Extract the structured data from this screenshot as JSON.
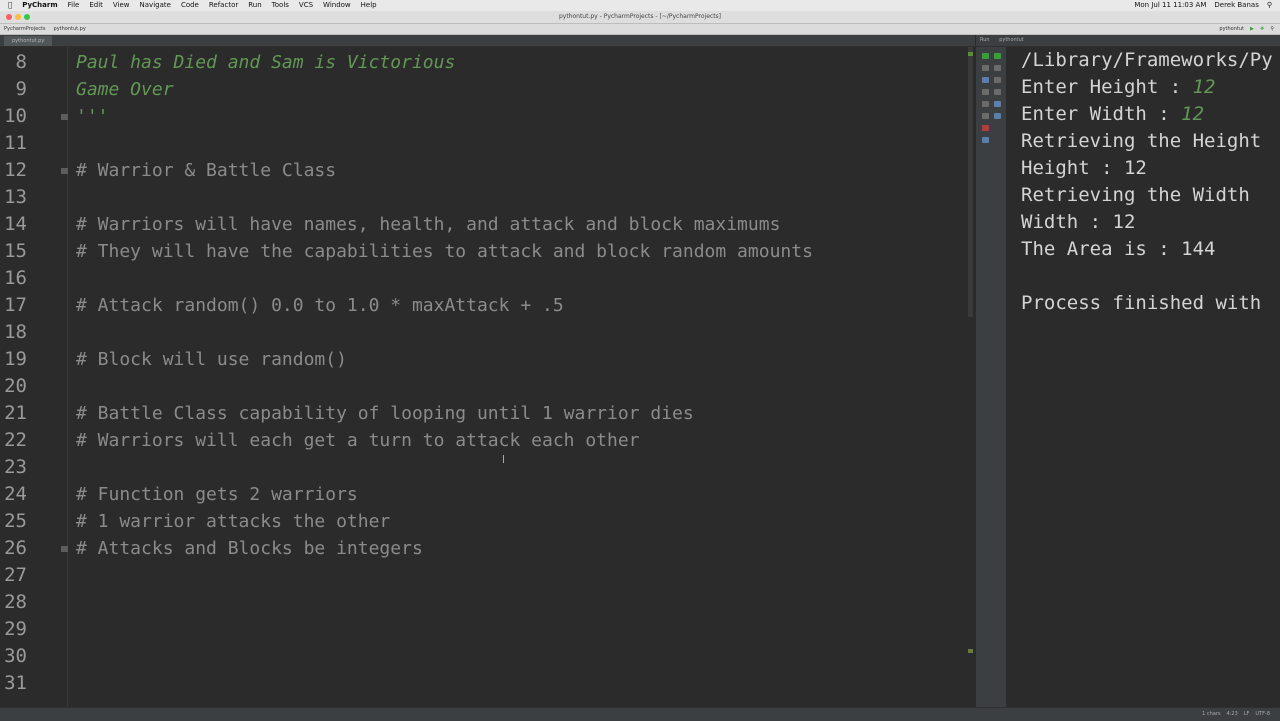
{
  "menubar": {
    "app": "PyCharm",
    "items": [
      "File",
      "Edit",
      "View",
      "Navigate",
      "Code",
      "Refactor",
      "Run",
      "Tools",
      "VCS",
      "Window",
      "Help"
    ],
    "clock": "Mon Jul 11  11:03 AM",
    "user": "Derek Banas"
  },
  "window": {
    "title": "pythontut.py - PycharmProjects - [~/PycharmProjects]"
  },
  "navbar": {
    "breadcrumbs": [
      "PycharmProjects",
      "pythontut.py"
    ],
    "run_config": "pythontut"
  },
  "editor": {
    "tab": "pythontut.py",
    "lines": [
      {
        "num": "8",
        "text": "Paul has Died and Sam is Victorious",
        "kind": "doc"
      },
      {
        "num": "9",
        "text": "Game Over",
        "kind": "doc"
      },
      {
        "num": "10",
        "text": "'''",
        "kind": "doc"
      },
      {
        "num": "11",
        "text": "",
        "kind": "code"
      },
      {
        "num": "12",
        "text": "# Warrior & Battle Class",
        "kind": "comment"
      },
      {
        "num": "13",
        "text": "",
        "kind": "code"
      },
      {
        "num": "14",
        "text": "# Warriors will have names, health, and attack and block maximums",
        "kind": "comment"
      },
      {
        "num": "15",
        "text": "# They will have the capabilities to attack and block random amounts",
        "kind": "comment"
      },
      {
        "num": "16",
        "text": "",
        "kind": "code"
      },
      {
        "num": "17",
        "text": "# Attack random() 0.0 to 1.0 * maxAttack + .5",
        "kind": "comment"
      },
      {
        "num": "18",
        "text": "",
        "kind": "code"
      },
      {
        "num": "19",
        "text": "# Block will use random()",
        "kind": "comment"
      },
      {
        "num": "20",
        "text": "",
        "kind": "code"
      },
      {
        "num": "21",
        "text": "# Battle Class capability of looping until 1 warrior dies",
        "kind": "comment"
      },
      {
        "num": "22",
        "text": "# Warriors will each get a turn to attack each other",
        "kind": "comment"
      },
      {
        "num": "23",
        "text": "",
        "kind": "code"
      },
      {
        "num": "24",
        "text": "# Function gets 2 warriors",
        "kind": "comment"
      },
      {
        "num": "25",
        "text": "# 1 warrior attacks the other",
        "kind": "comment"
      },
      {
        "num": "26",
        "text": "# Attacks and Blocks be integers",
        "kind": "comment"
      },
      {
        "num": "27",
        "text": "",
        "kind": "code"
      },
      {
        "num": "28",
        "text": "",
        "kind": "code"
      },
      {
        "num": "29",
        "text": "",
        "kind": "code"
      },
      {
        "num": "30",
        "text": "",
        "kind": "code"
      },
      {
        "num": "31",
        "text": "",
        "kind": "code"
      }
    ]
  },
  "run_panel": {
    "tab": "pythontut",
    "console": [
      {
        "prefix": "/Library/Frameworks/Py",
        "input": ""
      },
      {
        "prefix": "Enter Height : ",
        "input": "12"
      },
      {
        "prefix": "Enter Width : ",
        "input": "12"
      },
      {
        "prefix": "Retrieving the Height",
        "input": ""
      },
      {
        "prefix": "Height : 12",
        "input": ""
      },
      {
        "prefix": "Retrieving the Width",
        "input": ""
      },
      {
        "prefix": "Width : 12",
        "input": ""
      },
      {
        "prefix": "The Area is : 144",
        "input": ""
      },
      {
        "prefix": "",
        "input": ""
      },
      {
        "prefix": "Process finished with",
        "input": ""
      }
    ]
  },
  "statusbar": {
    "items": [
      "1 chars",
      "4:23",
      "LF",
      "UTF-8"
    ]
  },
  "colors": {
    "editor_bg": "#2b2b2b",
    "comment": "#8b8b8b",
    "docstring": "#629755",
    "line_number": "#9a9a9a",
    "console_text": "#d4d4d4"
  }
}
